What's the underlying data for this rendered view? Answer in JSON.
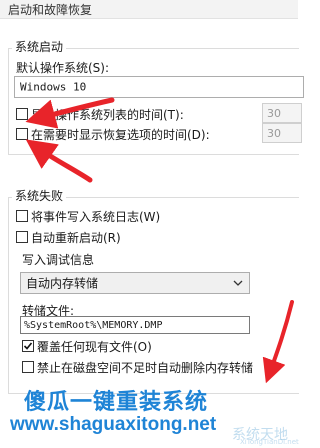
{
  "window": {
    "title": "启动和故障恢复"
  },
  "system_startup": {
    "group_label": "系统启动",
    "default_os_label": "默认操作系统(S):",
    "default_os_value": "Windows 10",
    "show_os_list_label": "显示操作系统列表的时间(T):",
    "show_os_list_checked": false,
    "os_list_seconds": "30",
    "show_recovery_label": "在需要时显示恢复选项的时间(D):",
    "show_recovery_checked": false,
    "recovery_seconds": "30"
  },
  "system_failure": {
    "group_label": "系统失败",
    "write_event_label": "将事件写入系统日志(W)",
    "write_event_checked": false,
    "auto_restart_label": "自动重新启动(R)",
    "auto_restart_checked": false,
    "debug_info_label": "写入调试信息",
    "debug_info_value": "自动内存转储",
    "dump_file_label": "转储文件:",
    "dump_file_value": "%SystemRoot%\\MEMORY.DMP",
    "overwrite_label": "覆盖任何现有文件(O)",
    "overwrite_checked": true,
    "disable_auto_delete_label": "禁止在磁盘空间不足时自动删除内存转储",
    "disable_auto_delete_checked": false
  },
  "watermark": {
    "brand_cn": "傻瓜一键重装系统",
    "url": "www.shaguaxitong.net",
    "logo_cn": "系统天地",
    "logo_en": "XiTongTianDi.net"
  },
  "colors": {
    "annotation_arrow": "#e8242a",
    "watermark": "#1f84d6"
  },
  "icons": [
    "chevron-down-icon",
    "checkmark-icon",
    "red-arrow-annotation"
  ]
}
